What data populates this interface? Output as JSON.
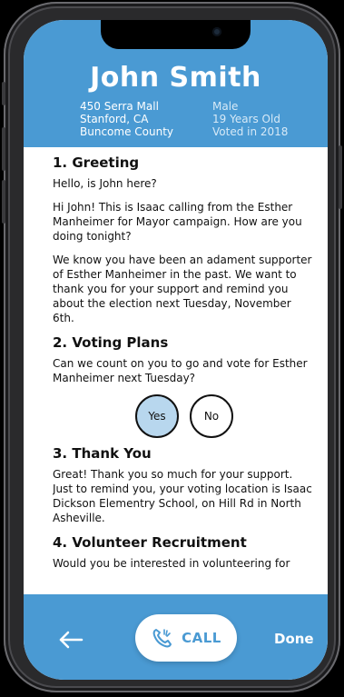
{
  "contact": {
    "name": "John Smith",
    "address_line1": "450 Serra Mall",
    "address_line2": "Stanford, CA",
    "county": "Buncome County",
    "gender": "Male",
    "age": "19 Years Old",
    "voted": "Voted in 2018"
  },
  "script": {
    "greeting": {
      "heading": "1. Greeting",
      "lines": [
        "Hello, is John here?",
        "Hi John! This is Isaac calling from the Esther Manheimer for Mayor campaign. How are you doing tonight?",
        "We know you have been an adament supporter of Esther Manheimer in the past. We want to thank you for your support and remind you about the election next Tuesday, November 6th."
      ]
    },
    "voting_plans": {
      "heading": "2. Voting Plans",
      "question": "Can we count on you to go and vote for Esther Manheimer next Tuesday?",
      "yes_label": "Yes",
      "no_label": "No",
      "selected": "Yes"
    },
    "thank_you": {
      "heading": "3. Thank You",
      "text": "Great! Thank you so much for your support. Just to remind you, your voting location is Isaac Dickson Elementry School, on Hill Rd in North Asheville."
    },
    "volunteer": {
      "heading": "4. Volunteer Recruitment",
      "text": "Would you be interested in volunteering for"
    }
  },
  "bottom_bar": {
    "back_icon": "arrow-left-icon",
    "call_icon": "phone-icon",
    "call_label": "CALL",
    "done_label": "Done"
  },
  "colors": {
    "primary": "#4a9ad3",
    "selected_choice": "#b8d7ee",
    "text": "#111111"
  }
}
